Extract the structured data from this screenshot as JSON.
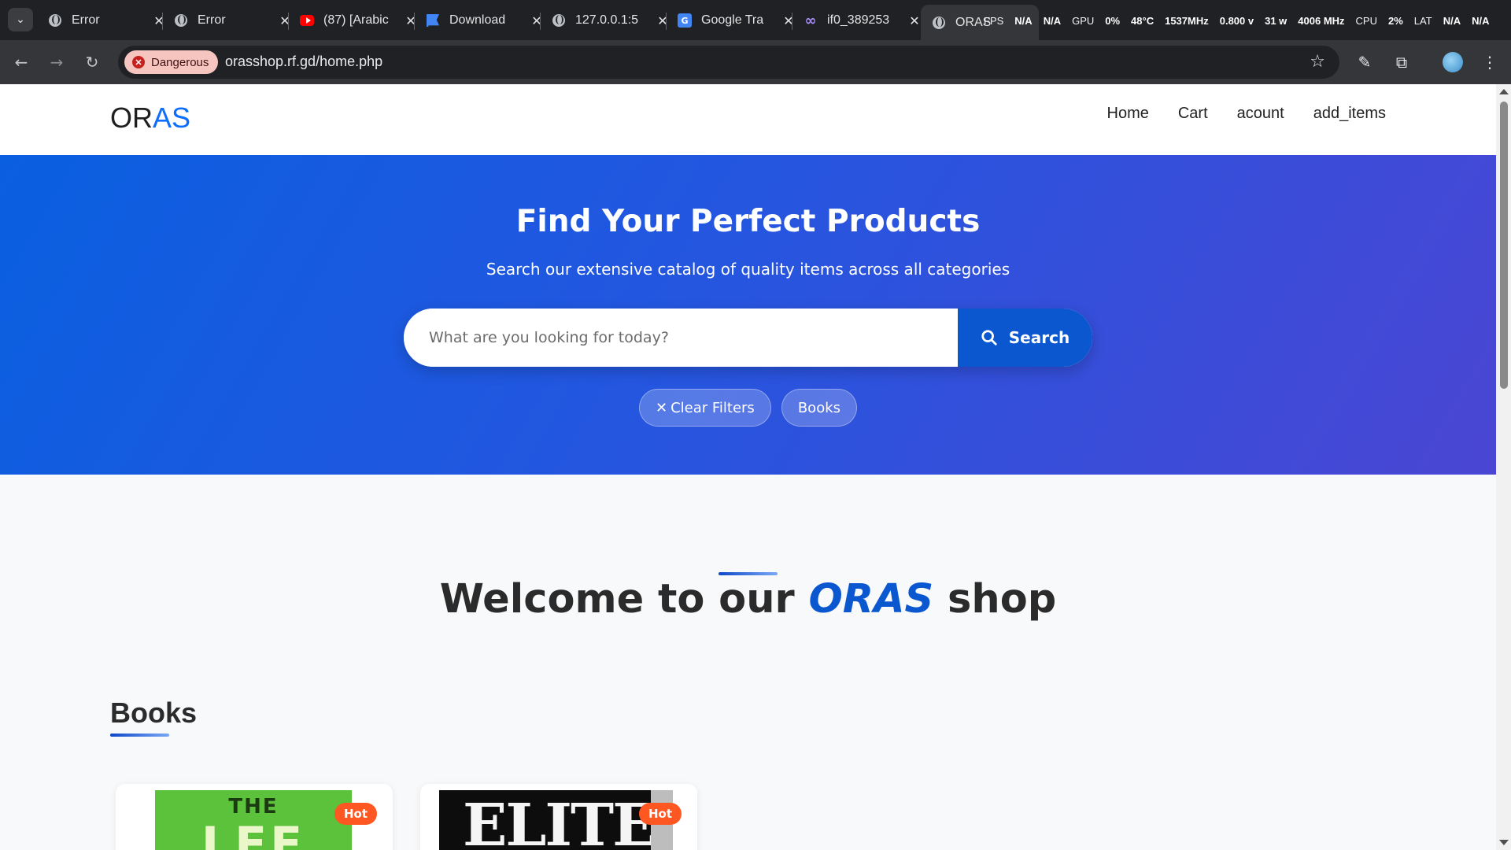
{
  "browser": {
    "tabs": [
      {
        "title": "Error",
        "icon": "globe-icon"
      },
      {
        "title": "Error",
        "icon": "globe-icon"
      },
      {
        "title": "(87) [Arabic",
        "icon": "youtube-icon"
      },
      {
        "title": "Download",
        "icon": "flag-icon"
      },
      {
        "title": "127.0.0.1:5",
        "icon": "globe-icon"
      },
      {
        "title": "Google Tra",
        "icon": "google-translate-icon"
      },
      {
        "title": "if0_389253",
        "icon": "infinity-icon"
      },
      {
        "title": "ORAS",
        "icon": "globe-icon",
        "active": true
      }
    ],
    "overlay": {
      "fps_label": "FPS",
      "fps_value": "N/A",
      "fps_value2": "N/A",
      "gpu_label": "GPU",
      "gpu_value": "0%",
      "temp": "48°C",
      "clock": "1537MHz",
      "voltage": "0.800 v",
      "power": "31 w",
      "mem_clock": "4006 MHz",
      "cpu_label": "CPU",
      "cpu_value": "2%",
      "lat_label": "LAT",
      "lat_value": "N/A",
      "lat_value2": "N/A"
    },
    "security_chip": "Dangerous",
    "url": "orasshop.rf.gd/home.php"
  },
  "site": {
    "logo_part1": "OR",
    "logo_part2": "AS",
    "nav": [
      "Home",
      "Cart",
      "acount",
      "add_items"
    ]
  },
  "hero": {
    "title": "Find Your Perfect Products",
    "subtitle": "Search our extensive catalog of quality items across all categories",
    "search_placeholder": "What are you looking for today?",
    "search_button": "Search",
    "filters": [
      "Clear Filters",
      "Books"
    ]
  },
  "welcome": {
    "prefix": "Welcome to our",
    "brand": "ORAS",
    "suffix": "shop"
  },
  "section": {
    "title": "Books",
    "products": [
      {
        "cover_text_top": "THE",
        "cover_text_main": "LEF",
        "badge": "Hot"
      },
      {
        "cover_text_main": "ELITE",
        "badge": "Hot"
      }
    ]
  },
  "colors": {
    "accent": "#0d6efd",
    "search_button": "#0b57d0",
    "badge": "#ff5722",
    "danger_chip": "#f7c5c0"
  }
}
